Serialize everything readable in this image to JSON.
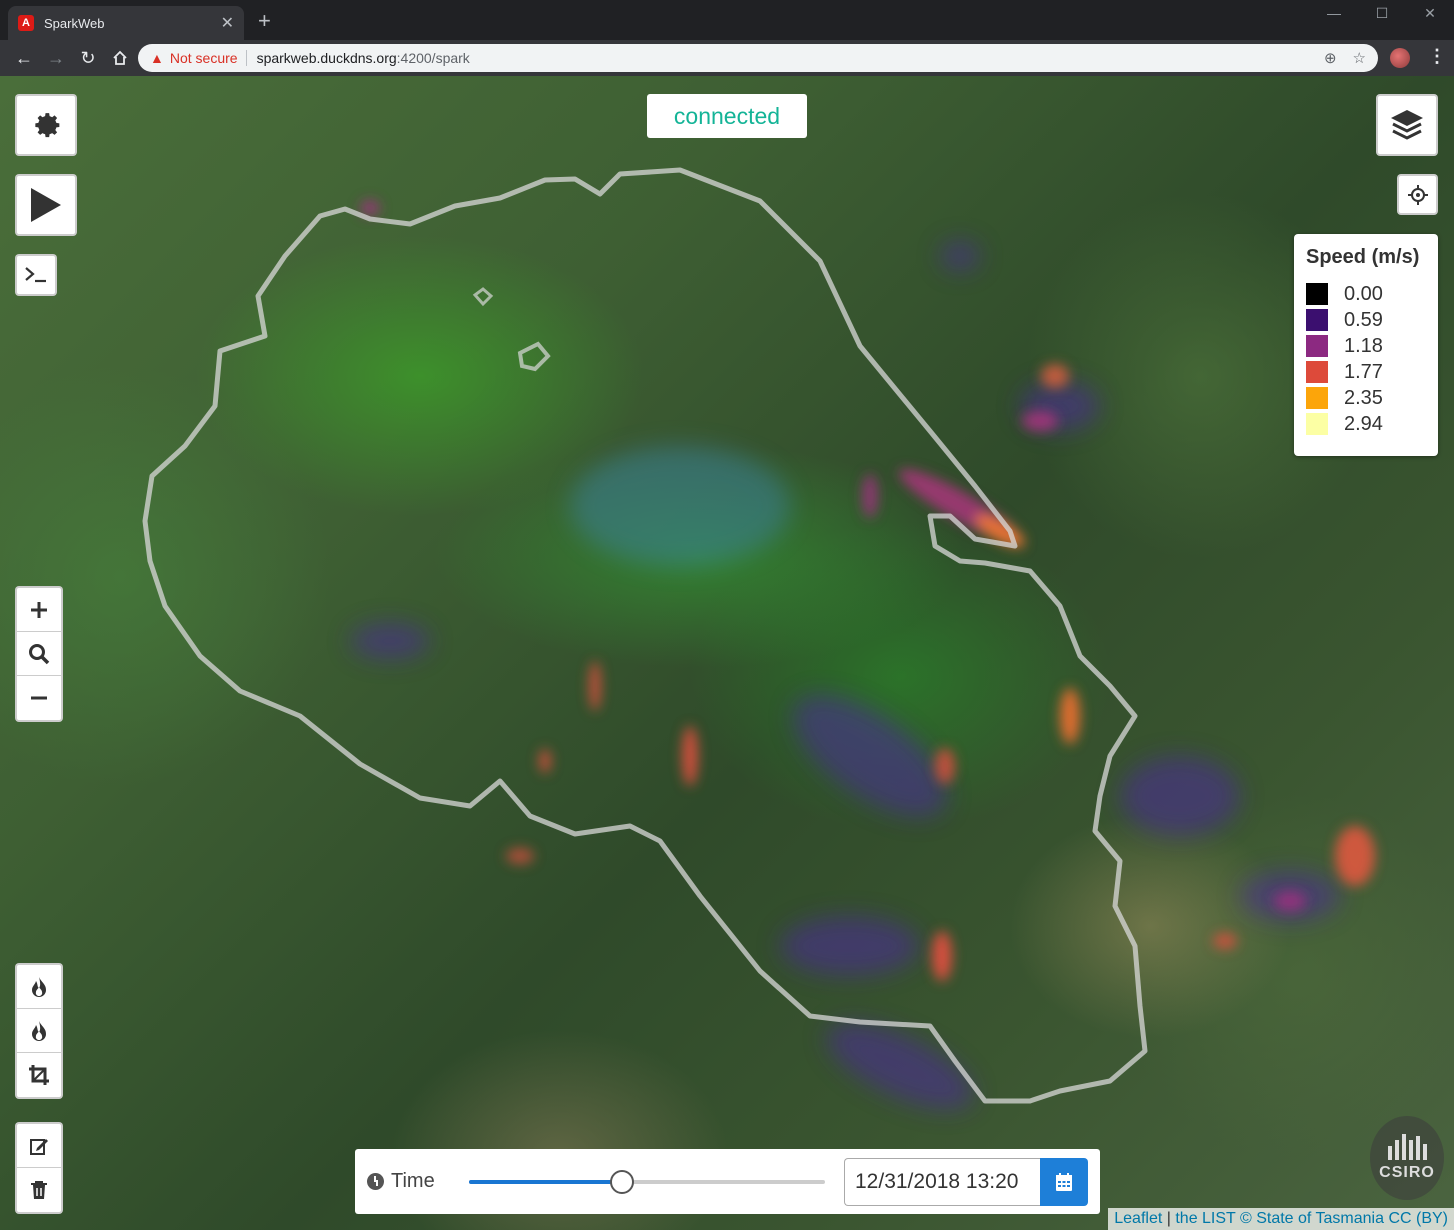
{
  "browser": {
    "tab_title": "SparkWeb",
    "tab_favicon": "A",
    "security_label": "Not secure",
    "url_host": "sparkweb.duckdns.org",
    "url_path": ":4200/spark"
  },
  "map": {
    "status": "connected",
    "legend": {
      "title": "Speed (m/s)",
      "items": [
        {
          "value": "0.00",
          "color": "#000000"
        },
        {
          "value": "0.59",
          "color": "#3b0f6f"
        },
        {
          "value": "1.18",
          "color": "#8c2981"
        },
        {
          "value": "1.77",
          "color": "#dd4a3a"
        },
        {
          "value": "2.35",
          "color": "#fca50a"
        },
        {
          "value": "2.94",
          "color": "#fcffa4"
        }
      ]
    },
    "controls": {
      "top_left": [
        "gear-icon",
        "play-icon",
        "terminal-icon"
      ],
      "zoom": [
        "plus-icon",
        "search-icon",
        "minus-icon"
      ],
      "tools": [
        "fire-icon",
        "fire-icon",
        "crop-icon"
      ],
      "edit": [
        "edit-icon",
        "trash-icon"
      ],
      "top_right": [
        "layers-icon",
        "locate-icon"
      ]
    },
    "time": {
      "label": "Time",
      "slider_value": 0.43,
      "datetime": "12/31/2018 13:20"
    },
    "attribution": {
      "leaflet": "Leaflet",
      "sep": " | ",
      "source": "the LIST © State of Tasmania CC (BY)"
    },
    "logo": "CSIRO",
    "colors": {
      "accent": "#1e7fd8",
      "status_text": "#14b497"
    }
  }
}
